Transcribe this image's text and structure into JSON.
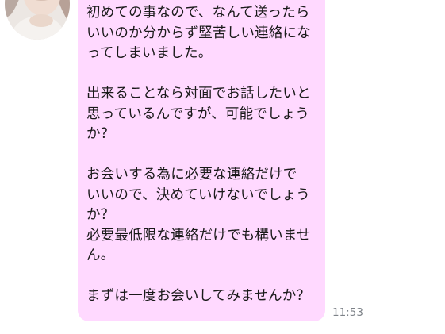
{
  "message": {
    "avatar_icon": "profile-photo",
    "bubble_color": "#ffd9ff",
    "text_color": "#1a1a1a",
    "text": "初めての事なので、なんて送ったら\nいいのか分からず堅苦しい連絡にな\nってしまいました。\n\n出来ることなら対面でお話したいと\n思っているんですが、可能でしょう\nか？\n\nお会いする為に必要な連絡だけで\nいいので、決めていけないでしょう\nか？\n必要最低限な連絡だけでも構いませ\nん。\n\nまずは一度お会いしてみませんか？",
    "time": "11:53"
  }
}
